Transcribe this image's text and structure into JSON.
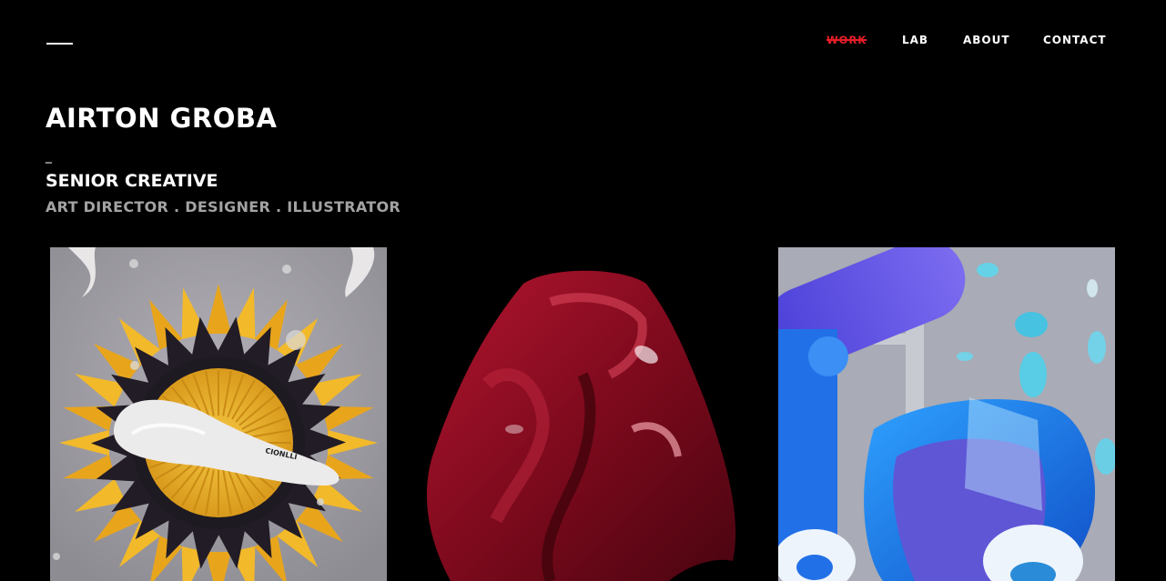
{
  "nav": {
    "items": [
      {
        "label": "WORK",
        "active": true
      },
      {
        "label": "LAB",
        "active": false
      },
      {
        "label": "ABOUT",
        "active": false
      },
      {
        "label": "CONTACT",
        "active": false
      }
    ],
    "active_color": "#e41e26"
  },
  "hero": {
    "name": "AIRTON GROBA",
    "dash": "_",
    "role": "SENIOR CREATIVE",
    "skills": "ART DIRECTOR . DESIGNER . ILLUSTRATOR"
  },
  "gallery": {
    "items": [
      {
        "artwork": "sunflower-brush",
        "product_label": "CIONLLI"
      },
      {
        "artwork": "red-draped-cloth"
      },
      {
        "artwork": "blue-plastic-objects"
      }
    ]
  }
}
